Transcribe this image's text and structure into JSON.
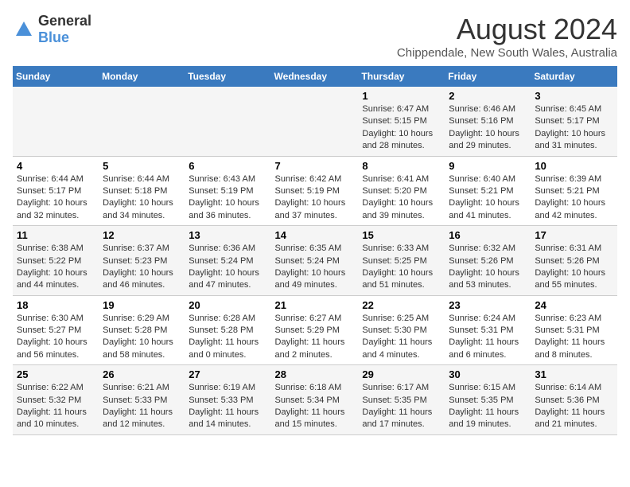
{
  "header": {
    "logo_general": "General",
    "logo_blue": "Blue",
    "main_title": "August 2024",
    "subtitle": "Chippendale, New South Wales, Australia"
  },
  "columns": [
    "Sunday",
    "Monday",
    "Tuesday",
    "Wednesday",
    "Thursday",
    "Friday",
    "Saturday"
  ],
  "weeks": [
    {
      "days": [
        {
          "num": "",
          "lines": []
        },
        {
          "num": "",
          "lines": []
        },
        {
          "num": "",
          "lines": []
        },
        {
          "num": "",
          "lines": []
        },
        {
          "num": "1",
          "lines": [
            "Sunrise: 6:47 AM",
            "Sunset: 5:15 PM",
            "Daylight: 10 hours",
            "and 28 minutes."
          ]
        },
        {
          "num": "2",
          "lines": [
            "Sunrise: 6:46 AM",
            "Sunset: 5:16 PM",
            "Daylight: 10 hours",
            "and 29 minutes."
          ]
        },
        {
          "num": "3",
          "lines": [
            "Sunrise: 6:45 AM",
            "Sunset: 5:17 PM",
            "Daylight: 10 hours",
            "and 31 minutes."
          ]
        }
      ]
    },
    {
      "days": [
        {
          "num": "4",
          "lines": [
            "Sunrise: 6:44 AM",
            "Sunset: 5:17 PM",
            "Daylight: 10 hours",
            "and 32 minutes."
          ]
        },
        {
          "num": "5",
          "lines": [
            "Sunrise: 6:44 AM",
            "Sunset: 5:18 PM",
            "Daylight: 10 hours",
            "and 34 minutes."
          ]
        },
        {
          "num": "6",
          "lines": [
            "Sunrise: 6:43 AM",
            "Sunset: 5:19 PM",
            "Daylight: 10 hours",
            "and 36 minutes."
          ]
        },
        {
          "num": "7",
          "lines": [
            "Sunrise: 6:42 AM",
            "Sunset: 5:19 PM",
            "Daylight: 10 hours",
            "and 37 minutes."
          ]
        },
        {
          "num": "8",
          "lines": [
            "Sunrise: 6:41 AM",
            "Sunset: 5:20 PM",
            "Daylight: 10 hours",
            "and 39 minutes."
          ]
        },
        {
          "num": "9",
          "lines": [
            "Sunrise: 6:40 AM",
            "Sunset: 5:21 PM",
            "Daylight: 10 hours",
            "and 41 minutes."
          ]
        },
        {
          "num": "10",
          "lines": [
            "Sunrise: 6:39 AM",
            "Sunset: 5:21 PM",
            "Daylight: 10 hours",
            "and 42 minutes."
          ]
        }
      ]
    },
    {
      "days": [
        {
          "num": "11",
          "lines": [
            "Sunrise: 6:38 AM",
            "Sunset: 5:22 PM",
            "Daylight: 10 hours",
            "and 44 minutes."
          ]
        },
        {
          "num": "12",
          "lines": [
            "Sunrise: 6:37 AM",
            "Sunset: 5:23 PM",
            "Daylight: 10 hours",
            "and 46 minutes."
          ]
        },
        {
          "num": "13",
          "lines": [
            "Sunrise: 6:36 AM",
            "Sunset: 5:24 PM",
            "Daylight: 10 hours",
            "and 47 minutes."
          ]
        },
        {
          "num": "14",
          "lines": [
            "Sunrise: 6:35 AM",
            "Sunset: 5:24 PM",
            "Daylight: 10 hours",
            "and 49 minutes."
          ]
        },
        {
          "num": "15",
          "lines": [
            "Sunrise: 6:33 AM",
            "Sunset: 5:25 PM",
            "Daylight: 10 hours",
            "and 51 minutes."
          ]
        },
        {
          "num": "16",
          "lines": [
            "Sunrise: 6:32 AM",
            "Sunset: 5:26 PM",
            "Daylight: 10 hours",
            "and 53 minutes."
          ]
        },
        {
          "num": "17",
          "lines": [
            "Sunrise: 6:31 AM",
            "Sunset: 5:26 PM",
            "Daylight: 10 hours",
            "and 55 minutes."
          ]
        }
      ]
    },
    {
      "days": [
        {
          "num": "18",
          "lines": [
            "Sunrise: 6:30 AM",
            "Sunset: 5:27 PM",
            "Daylight: 10 hours",
            "and 56 minutes."
          ]
        },
        {
          "num": "19",
          "lines": [
            "Sunrise: 6:29 AM",
            "Sunset: 5:28 PM",
            "Daylight: 10 hours",
            "and 58 minutes."
          ]
        },
        {
          "num": "20",
          "lines": [
            "Sunrise: 6:28 AM",
            "Sunset: 5:28 PM",
            "Daylight: 11 hours",
            "and 0 minutes."
          ]
        },
        {
          "num": "21",
          "lines": [
            "Sunrise: 6:27 AM",
            "Sunset: 5:29 PM",
            "Daylight: 11 hours",
            "and 2 minutes."
          ]
        },
        {
          "num": "22",
          "lines": [
            "Sunrise: 6:25 AM",
            "Sunset: 5:30 PM",
            "Daylight: 11 hours",
            "and 4 minutes."
          ]
        },
        {
          "num": "23",
          "lines": [
            "Sunrise: 6:24 AM",
            "Sunset: 5:31 PM",
            "Daylight: 11 hours",
            "and 6 minutes."
          ]
        },
        {
          "num": "24",
          "lines": [
            "Sunrise: 6:23 AM",
            "Sunset: 5:31 PM",
            "Daylight: 11 hours",
            "and 8 minutes."
          ]
        }
      ]
    },
    {
      "days": [
        {
          "num": "25",
          "lines": [
            "Sunrise: 6:22 AM",
            "Sunset: 5:32 PM",
            "Daylight: 11 hours",
            "and 10 minutes."
          ]
        },
        {
          "num": "26",
          "lines": [
            "Sunrise: 6:21 AM",
            "Sunset: 5:33 PM",
            "Daylight: 11 hours",
            "and 12 minutes."
          ]
        },
        {
          "num": "27",
          "lines": [
            "Sunrise: 6:19 AM",
            "Sunset: 5:33 PM",
            "Daylight: 11 hours",
            "and 14 minutes."
          ]
        },
        {
          "num": "28",
          "lines": [
            "Sunrise: 6:18 AM",
            "Sunset: 5:34 PM",
            "Daylight: 11 hours",
            "and 15 minutes."
          ]
        },
        {
          "num": "29",
          "lines": [
            "Sunrise: 6:17 AM",
            "Sunset: 5:35 PM",
            "Daylight: 11 hours",
            "and 17 minutes."
          ]
        },
        {
          "num": "30",
          "lines": [
            "Sunrise: 6:15 AM",
            "Sunset: 5:35 PM",
            "Daylight: 11 hours",
            "and 19 minutes."
          ]
        },
        {
          "num": "31",
          "lines": [
            "Sunrise: 6:14 AM",
            "Sunset: 5:36 PM",
            "Daylight: 11 hours",
            "and 21 minutes."
          ]
        }
      ]
    }
  ]
}
